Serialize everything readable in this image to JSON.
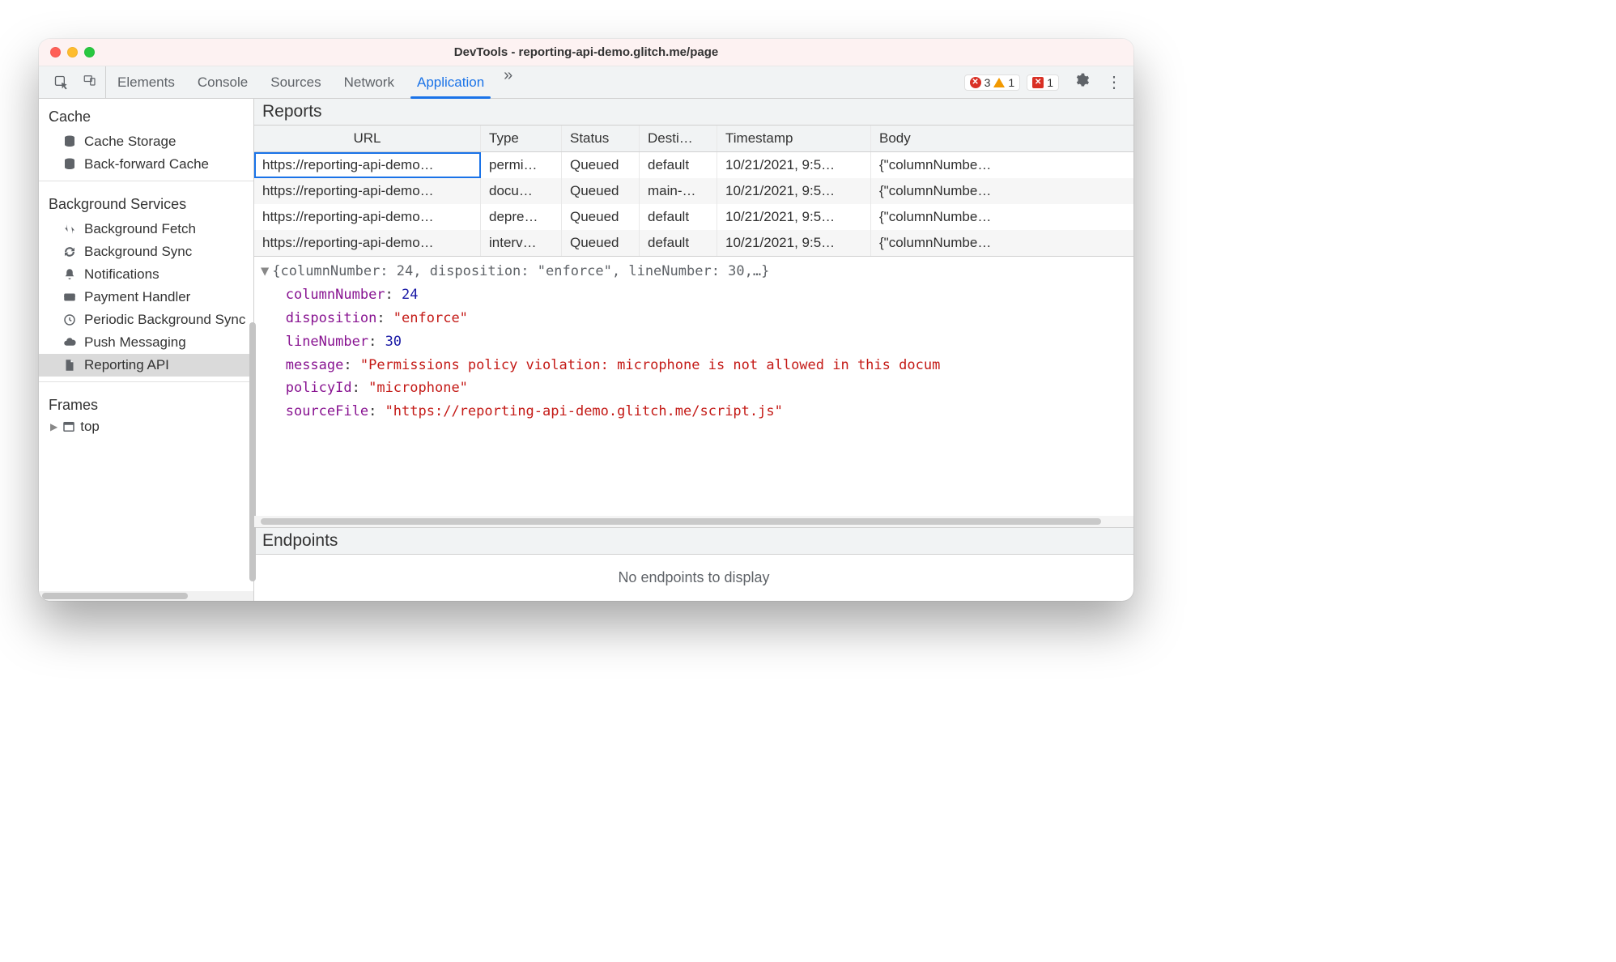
{
  "window": {
    "title": "DevTools - reporting-api-demo.glitch.me/page"
  },
  "tabs": {
    "items": [
      "Elements",
      "Console",
      "Sources",
      "Network",
      "Application"
    ],
    "active": "Application",
    "more": "»"
  },
  "toolbar_counts": {
    "errors": "3",
    "warnings": "1",
    "hidden_errors": "1"
  },
  "sidebar": {
    "cache_title": "Cache",
    "cache_items": [
      "Cache Storage",
      "Back-forward Cache"
    ],
    "bg_title": "Background Services",
    "bg_items": [
      "Background Fetch",
      "Background Sync",
      "Notifications",
      "Payment Handler",
      "Periodic Background Sync",
      "Push Messaging",
      "Reporting API"
    ],
    "frames_title": "Frames",
    "frames_item": "top"
  },
  "panes": {
    "reports_title": "Reports",
    "endpoints_title": "Endpoints",
    "endpoints_empty": "No endpoints to display"
  },
  "reports": {
    "columns": [
      "URL",
      "Type",
      "Status",
      "Desti…",
      "Timestamp",
      "Body"
    ],
    "rows": [
      {
        "url": "https://reporting-api-demo…",
        "type": "permi…",
        "status": "Queued",
        "dest": "default",
        "ts": "10/21/2021, 9:5…",
        "body": "{\"columnNumbe…"
      },
      {
        "url": "https://reporting-api-demo…",
        "type": "docu…",
        "status": "Queued",
        "dest": "main-…",
        "ts": "10/21/2021, 9:5…",
        "body": "{\"columnNumbe…"
      },
      {
        "url": "https://reporting-api-demo…",
        "type": "depre…",
        "status": "Queued",
        "dest": "default",
        "ts": "10/21/2021, 9:5…",
        "body": "{\"columnNumbe…"
      },
      {
        "url": "https://reporting-api-demo…",
        "type": "interv…",
        "status": "Queued",
        "dest": "default",
        "ts": "10/21/2021, 9:5…",
        "body": "{\"columnNumbe…"
      }
    ]
  },
  "detail": {
    "summary": "{columnNumber: 24, disposition: \"enforce\", lineNumber: 30,…}",
    "columnNumber_k": "columnNumber",
    "columnNumber_v": "24",
    "disposition_k": "disposition",
    "disposition_v": "\"enforce\"",
    "lineNumber_k": "lineNumber",
    "lineNumber_v": "30",
    "message_k": "message",
    "message_v": "\"Permissions policy violation: microphone is not allowed in this docum",
    "policyId_k": "policyId",
    "policyId_v": "\"microphone\"",
    "sourceFile_k": "sourceFile",
    "sourceFile_v": "\"https://reporting-api-demo.glitch.me/script.js\""
  }
}
